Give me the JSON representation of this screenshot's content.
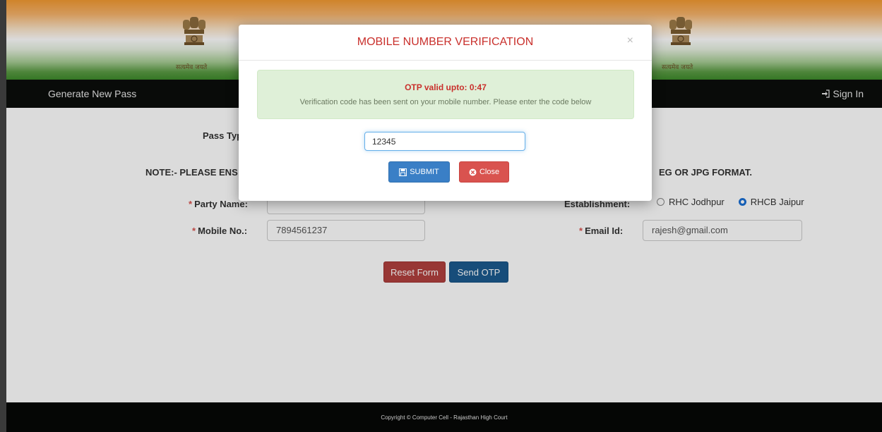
{
  "header": {
    "emblem_caption_left": "सत्यमेव जयते",
    "emblem_caption_right": "सत्यमेव जयते"
  },
  "navbar": {
    "generate_label": "Generate New Pass",
    "signin_label": "Sign In",
    "signin_icon": "sign-in-icon"
  },
  "form": {
    "pass_type_label": "Pass Typ",
    "note": "NOTE:- PLEASE ENS",
    "note_right": "EG OR JPG FORMAT.",
    "party_name_label": "Party Name:",
    "establishment_label": "Establishment:",
    "establishment_options": [
      "RHC Jodhpur",
      "RHCB Jaipur"
    ],
    "establishment_selected": "RHCB Jaipur",
    "mobile_label": "Mobile No.:",
    "mobile_value": "7894561237",
    "email_label": "Email Id:",
    "email_value": "rajesh@gmail.com",
    "reset_label": "Reset Form",
    "send_otp_label": "Send OTP"
  },
  "modal": {
    "title": "MOBILE NUMBER VERIFICATION",
    "close_symbol": "×",
    "otp_validity": "OTP valid upto: 0:47",
    "message": "Verification code has been sent on your mobile number. Please enter the code below",
    "otp_value": "12345",
    "submit_label": "SUBMIT",
    "close_label": "Close"
  },
  "footer": {
    "copyright": "Copyright © Computer Cell - Rajasthan High Court"
  },
  "colors": {
    "title_red": "#c9302c",
    "navbar_bg": "#0b0d0b",
    "submit_blue": "#3a7fc6",
    "close_red": "#d9534f"
  }
}
